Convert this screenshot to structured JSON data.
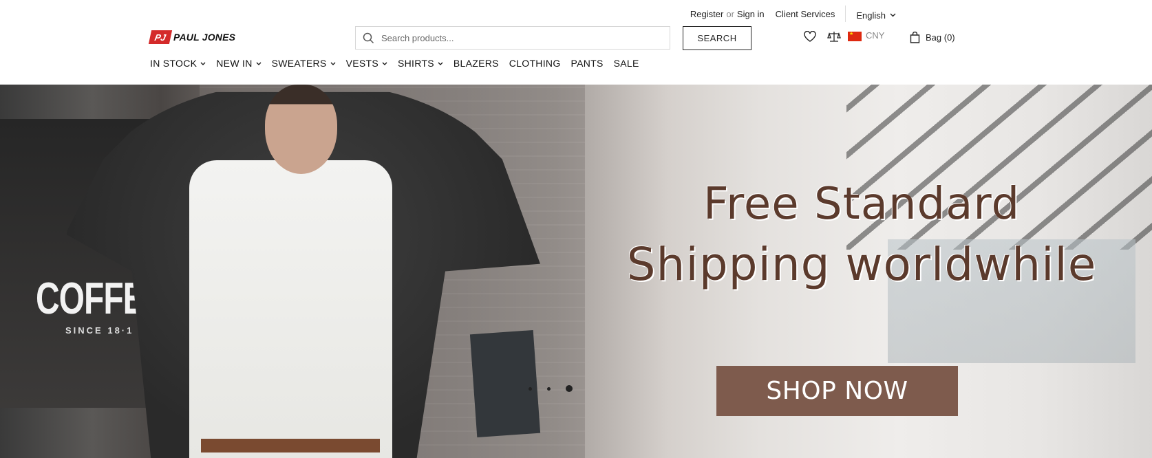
{
  "topbar": {
    "register": "Register",
    "or": "or",
    "sign_in": "Sign in",
    "client_services": "Client Services",
    "language": "English"
  },
  "brand": {
    "mark": "PJ",
    "name": "PAUL JONES",
    "color": "#d42a2a"
  },
  "search": {
    "placeholder": "Search products...",
    "value": "",
    "button": "SEARCH"
  },
  "utility": {
    "currency": "CNY",
    "bag": "Bag (0)",
    "icons": [
      "heart-icon",
      "compare-icon",
      "china-flag-icon",
      "bag-icon"
    ]
  },
  "nav": {
    "items": [
      {
        "label": "IN STOCK",
        "has_dropdown": true
      },
      {
        "label": "NEW IN",
        "has_dropdown": true
      },
      {
        "label": "SWEATERS",
        "has_dropdown": true
      },
      {
        "label": "VESTS",
        "has_dropdown": true
      },
      {
        "label": "SHIRTS",
        "has_dropdown": true
      },
      {
        "label": "BLAZERS",
        "has_dropdown": false
      },
      {
        "label": "CLOTHING",
        "has_dropdown": false
      },
      {
        "label": "PANTS",
        "has_dropdown": false
      },
      {
        "label": "SALE",
        "has_dropdown": false
      }
    ]
  },
  "hero": {
    "headline_line1": "Free Standard",
    "headline_line2": "Shipping worldwhile",
    "cta": "SHOP NOW",
    "scene_text_1": "COFFEE SHOP",
    "scene_text_2": "SINCE 18·1",
    "slides": 3,
    "active_slide": 3,
    "headline_color": "#5b3a2c",
    "cta_color": "#7e5b4d"
  }
}
